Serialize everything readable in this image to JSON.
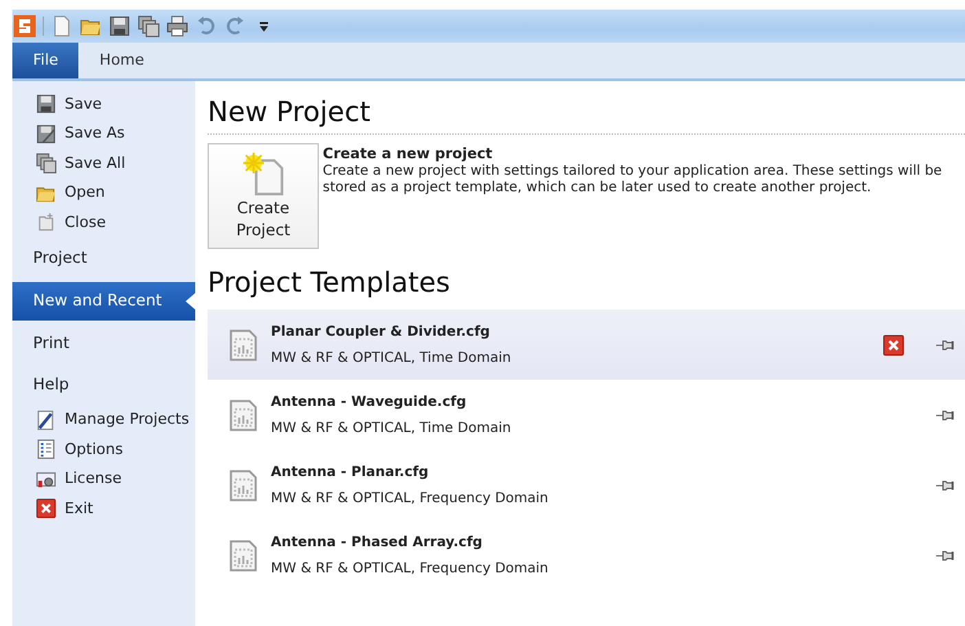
{
  "ribbon_tabs": [
    {
      "label": "File",
      "selected": true
    },
    {
      "label": "Home",
      "selected": false
    }
  ],
  "sidebar": {
    "items": [
      {
        "kind": "command",
        "label": "Save",
        "selected": false
      },
      {
        "kind": "command",
        "label": "Save As",
        "selected": false
      },
      {
        "kind": "command",
        "label": "Save All",
        "selected": false
      },
      {
        "kind": "command",
        "label": "Open",
        "selected": false
      },
      {
        "kind": "command",
        "label": "Close",
        "selected": false
      },
      {
        "kind": "section",
        "label": "Project",
        "selected": false
      },
      {
        "kind": "section",
        "label": "New and Recent",
        "selected": true
      },
      {
        "kind": "section",
        "label": "Print",
        "selected": false
      },
      {
        "kind": "section",
        "label": "Help",
        "selected": false
      },
      {
        "kind": "command",
        "label": "Manage Projects",
        "selected": false
      },
      {
        "kind": "command",
        "label": "Options",
        "selected": false
      },
      {
        "kind": "command",
        "label": "License",
        "selected": false
      },
      {
        "kind": "command",
        "label": "Exit",
        "selected": false
      }
    ]
  },
  "new_project": {
    "heading": "New Project",
    "button_label": "Create Project",
    "title": "Create a new project",
    "description": "Create a new project with settings tailored to your application area. These settings will be stored as a project template, which can be later used to create another project."
  },
  "project_templates": {
    "heading": "Project Templates",
    "items": [
      {
        "name": "Planar Coupler & Divider.cfg",
        "details": "MW & RF & OPTICAL, Time Domain",
        "highlighted": true
      },
      {
        "name": "Antenna - Waveguide.cfg",
        "details": "MW & RF & OPTICAL, Time Domain",
        "highlighted": false
      },
      {
        "name": "Antenna - Planar.cfg",
        "details": "MW & RF & OPTICAL, Frequency Domain",
        "highlighted": false
      },
      {
        "name": "Antenna - Phased Array.cfg",
        "details": "MW & RF & OPTICAL, Frequency Domain",
        "highlighted": false
      }
    ]
  }
}
